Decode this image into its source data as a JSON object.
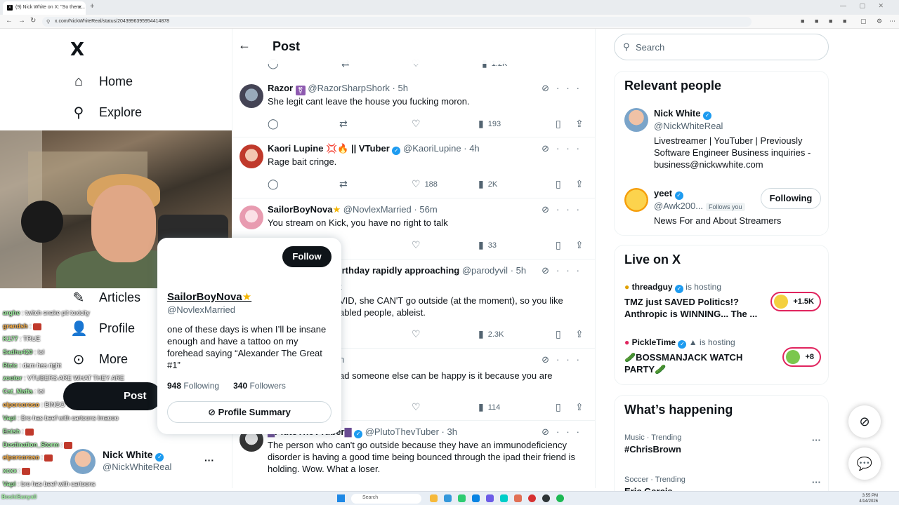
{
  "browser": {
    "tab_title": "(9) Nick White on X: \"So there...",
    "url": "x.com/NickWhiteReal/status/2043996395954414878"
  },
  "nav": {
    "logo": "X",
    "home": "Home",
    "explore": "Explore",
    "articles": "Articles",
    "profile": "Profile",
    "more": "More",
    "post_button": "Post"
  },
  "current_user": {
    "name": "Nick White",
    "handle": "@NickWhiteReal"
  },
  "chat": [
    {
      "user": "arghe",
      "msg": ": twitch snake pit toxicity"
    },
    {
      "user": "grandsh",
      "msg": ":"
    },
    {
      "user": "K177",
      "msg": ": TRUE"
    },
    {
      "user": "Sadhu420",
      "msg": ": lol"
    },
    {
      "user": "Rizic",
      "msg": ": dam hes right"
    },
    {
      "user": "zootor",
      "msg": ": VTUBERS ARE WHAT THEY ARE"
    },
    {
      "user": "Cat_Mafia",
      "msg": ": lol"
    },
    {
      "user": "elporcoroso",
      "msg": ": BINGO"
    },
    {
      "user": "Vapi",
      "msg": ": Bro has beef with cartoons lmaooo"
    },
    {
      "user": "Enish",
      "msg": ":"
    },
    {
      "user": "Destination_Storm",
      "msg": ":"
    },
    {
      "user": "elporcoroso",
      "msg": ":"
    },
    {
      "user": "xcxx",
      "msg": ":"
    },
    {
      "user": "Vapi",
      "msg": ": bro has beef with cartoons"
    },
    {
      "user": "BoshiSanya0",
      "msg": ":"
    }
  ],
  "main": {
    "title": "Post",
    "top_actions": {
      "views": "1.2K"
    },
    "replies": [
      {
        "name": "Razor",
        "handle": "@RazorSharpShork",
        "time": "5h",
        "text": "She legit cant leave the house you fucking moron.",
        "likes": "",
        "views": "193"
      },
      {
        "name": "Kaori Lupine 💢🔥 || VTuber",
        "handle": "@KaoriLupine",
        "time": "4h",
        "text": "Rage bait cringe.",
        "likes": "188",
        "views": "2K"
      },
      {
        "name": "SailorBoyNova",
        "handle": "@NovlexMarried",
        "time": "56m",
        "text": "You stream on Kick, you have no right to talk",
        "likes": "",
        "views": "33"
      },
      {
        "name": "irthday rapidly approaching",
        "handle": "@parodyvil",
        "time": "5h",
        "text": "VID, she CAN'T go outside (at the moment),  so you like abled people, ableist.",
        "text_line1": "VID, she CAN'T go outside (at the moment),  so you like",
        "text_line2": "abled people, ableist.",
        "sub": "t",
        "likes": "",
        "views": "2.3K"
      },
      {
        "name": "",
        "handle": "",
        "time": "h",
        "text": "ad someone else can be happy is it because you are",
        "likes": "",
        "views": "114"
      },
      {
        "name": "PlutoTheVTuber",
        "handle": "@PlutoThevTuber",
        "time": "3h",
        "text": "The person who can't go outside because they have an immunodeficiency disorder is having a good time being bounced through the ipad their friend is holding. Wow. What a loser.",
        "likes": "",
        "views": ""
      }
    ]
  },
  "hovercard": {
    "follow": "Follow",
    "name": "SailorBoyNova",
    "handle": "@NovlexMarried",
    "bio": "one of these days is when I’ll be insane enough and have a tattoo on my forehead saying “Alexander The Great #1”",
    "following_count": "948",
    "following_label": "Following",
    "followers_count": "340",
    "followers_label": "Followers",
    "summary": "Profile Summary"
  },
  "right": {
    "search_placeholder": "Search",
    "relevant": {
      "title": "Relevant people",
      "people": [
        {
          "name": "Nick White",
          "handle": "@NickWhiteReal",
          "bio": "Livestreamer | YouTuber | Previously Software Engineer Business inquiries - business@nickwwhite.com"
        },
        {
          "name": "yeet",
          "handle": "@Awk200...",
          "follows_you": "Follows you",
          "bio": "News For and About Streamers",
          "button": "Following"
        }
      ]
    },
    "live": {
      "title": "Live on X",
      "items": [
        {
          "host": "threadguy",
          "hosting": "is hosting",
          "title": "TMZ just SAVED Politics!? Anthropic is WINNING... The ...",
          "count": "+1.5K"
        },
        {
          "host": "PickleTime",
          "hosting": "is hosting",
          "title": "🥒BOSSMANJACK WATCH PARTY🥒",
          "count": "+8"
        }
      ]
    },
    "happening": {
      "title": "What’s happening",
      "trends": [
        {
          "context": "Music · Trending",
          "name": "#ChrisBrown"
        },
        {
          "context": "Soccer · Trending",
          "name": "Eric Garcia"
        }
      ]
    }
  },
  "taskbar": {
    "search": "Search",
    "time": "3:55 PM",
    "date": "4/14/2026"
  },
  "colors": {
    "accent": "#1d9bf0",
    "text": "#0f1419",
    "muted": "#536471",
    "live": "#e0245e"
  }
}
